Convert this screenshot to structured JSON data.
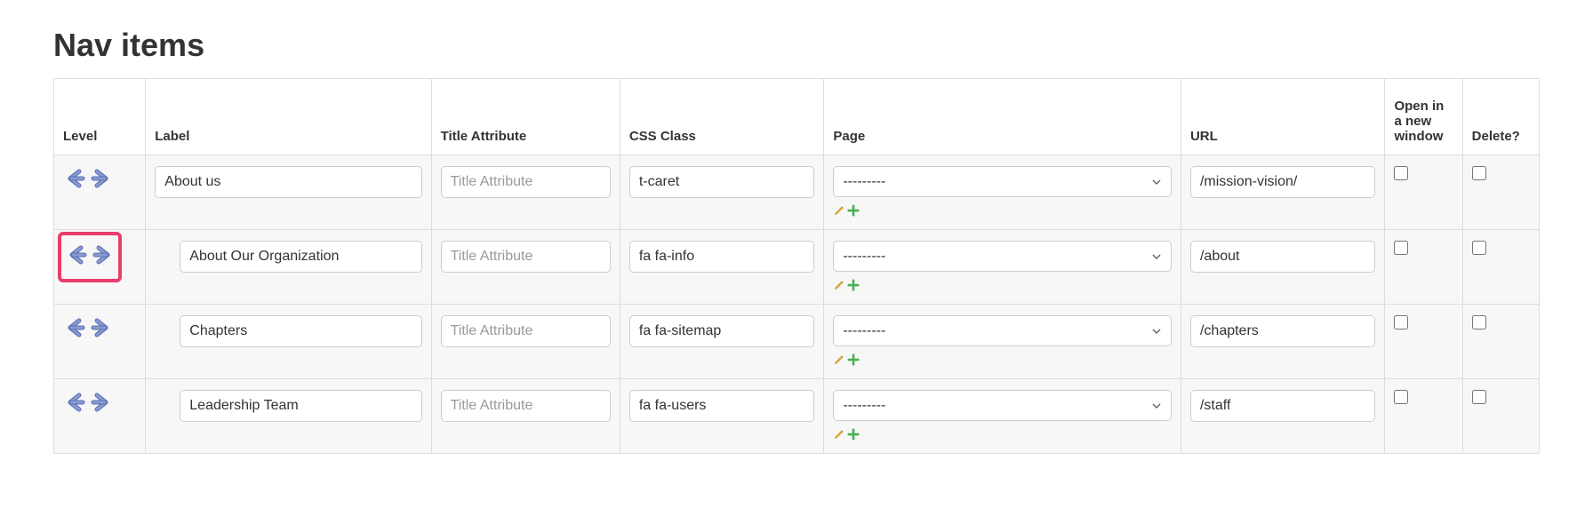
{
  "section_title": "Nav items",
  "headers": {
    "level": "Level",
    "label": "Label",
    "title_attr": "Title Attribute",
    "css_class": "CSS Class",
    "page": "Page",
    "url": "URL",
    "open_new": "Open in a new window",
    "delete": "Delete?"
  },
  "placeholders": {
    "title_attr": "Title Attribute"
  },
  "page_select_placeholder": "---------",
  "rows": [
    {
      "highlight_level": false,
      "indent": 0,
      "label": "About us",
      "title_attr": "",
      "css_class": "t-caret",
      "page": "---------",
      "url": "/mission-vision/",
      "open_new": false,
      "delete": false
    },
    {
      "highlight_level": true,
      "indent": 1,
      "label": "About Our Organization",
      "title_attr": "",
      "css_class": "fa fa-info",
      "page": "---------",
      "url": "/about",
      "open_new": false,
      "delete": false
    },
    {
      "highlight_level": false,
      "indent": 1,
      "label": "Chapters",
      "title_attr": "",
      "css_class": "fa fa-sitemap",
      "page": "---------",
      "url": "/chapters",
      "open_new": false,
      "delete": false
    },
    {
      "highlight_level": false,
      "indent": 1,
      "label": "Leadership Team",
      "title_attr": "",
      "css_class": "fa fa-users",
      "page": "---------",
      "url": "/staff",
      "open_new": false,
      "delete": false
    }
  ]
}
